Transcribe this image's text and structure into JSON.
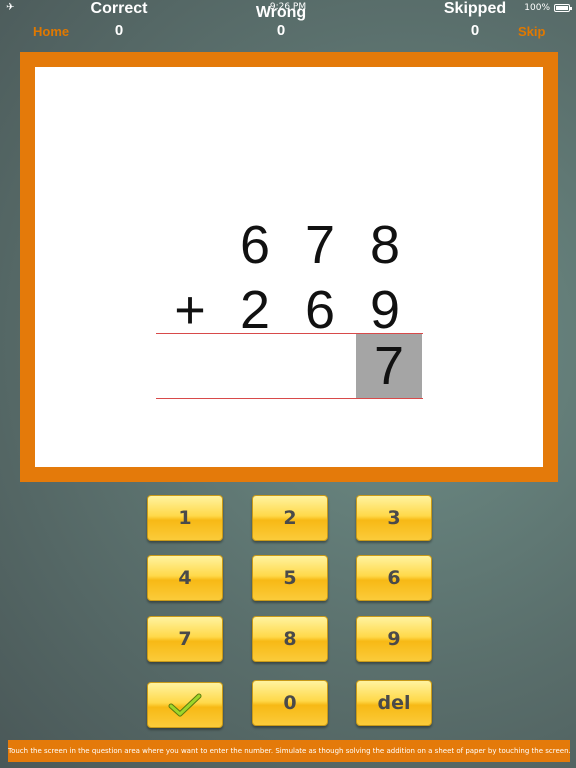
{
  "status_bar": {
    "time": "9:26 PM",
    "battery": "100%"
  },
  "header": {
    "correct_label": "Correct",
    "correct_value": "0",
    "wrong_label": "Wrong",
    "wrong_value": "0",
    "skipped_label": "Skipped",
    "skipped_value": "0",
    "home_label": "Home",
    "skip_label": "Skip"
  },
  "problem": {
    "top_digits": [
      "6",
      "7",
      "8"
    ],
    "bottom_digits": [
      "2",
      "6",
      "9"
    ],
    "operator": "+",
    "answer_digits": [
      "",
      "",
      "7"
    ]
  },
  "keypad": {
    "keys": [
      "1",
      "2",
      "3",
      "4",
      "5",
      "6",
      "7",
      "8",
      "9",
      "0",
      "del"
    ]
  },
  "hint": "Touch the screen in the question area where you want to enter the number. Simulate as though solving the addition on a sheet of paper by touching the screen.",
  "colors": {
    "accent": "#e47a0a",
    "key": "#ffd94a",
    "answer_highlight": "#a5a5a5",
    "rule": "#d84a4a"
  }
}
